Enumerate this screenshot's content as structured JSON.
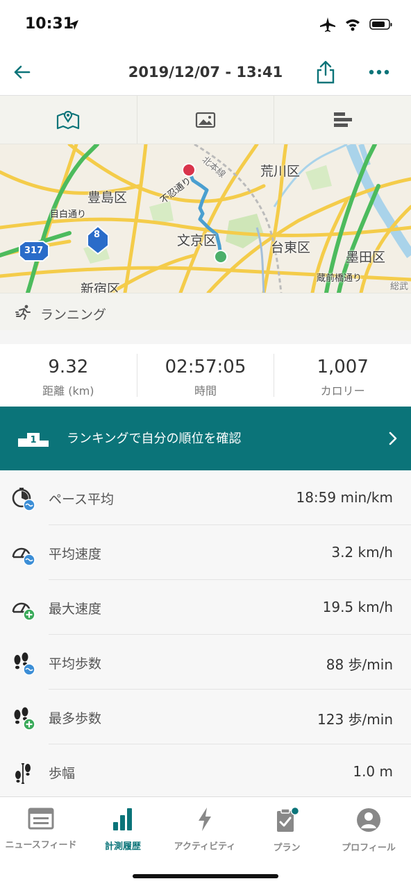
{
  "status": {
    "time": "10:31"
  },
  "header": {
    "title": "2019/12/07 - 13:41"
  },
  "view_tabs": [
    {
      "icon": "map-icon",
      "active": true
    },
    {
      "icon": "photo-icon",
      "active": false
    },
    {
      "icon": "stats-bars-icon",
      "active": false
    }
  ],
  "map": {
    "labels": {
      "arakawa": "荒川区",
      "toshima": "豊島区",
      "mejiro": "目白通り",
      "shinobazu": "不忍通り",
      "bunkyo": "文京区",
      "taito": "台東区",
      "sumida": "墨田区",
      "shinjuku": "新宿区",
      "kuramae": "蔵前橋通り",
      "sobu": "総武",
      "route8": "8",
      "route317": "317",
      "kitahon": "北本線"
    }
  },
  "activity": {
    "type": "ランニング"
  },
  "summary": {
    "distance": {
      "value": "9.32",
      "label": "距離 (km)"
    },
    "duration": {
      "value": "02:57:05",
      "label": "時間"
    },
    "calories": {
      "value": "1,007",
      "label": "カロリー"
    }
  },
  "ranking": {
    "rank": "1",
    "text": "ランキングで自分の順位を確認"
  },
  "metrics": [
    {
      "icon": "pace-avg-icon",
      "label": "ペース平均",
      "value": "18:59 min/km"
    },
    {
      "icon": "speed-avg-icon",
      "label": "平均速度",
      "value": "3.2 km/h"
    },
    {
      "icon": "speed-max-icon",
      "label": "最大速度",
      "value": "19.5 km/h"
    },
    {
      "icon": "cadence-avg-icon",
      "label": "平均歩数",
      "value": "88 歩/min"
    },
    {
      "icon": "cadence-max-icon",
      "label": "最多歩数",
      "value": "123 歩/min"
    },
    {
      "icon": "stride-icon",
      "label": "歩幅",
      "value": "1.0 m"
    }
  ],
  "tabbar": {
    "items": [
      {
        "icon": "newsfeed-icon",
        "label": "ニュースフィード",
        "active": false
      },
      {
        "icon": "history-icon",
        "label": "計測履歴",
        "active": true
      },
      {
        "icon": "activity-bolt-icon",
        "label": "アクティビティ",
        "active": false
      },
      {
        "icon": "plan-clipboard-icon",
        "label": "プラン",
        "active": false
      },
      {
        "icon": "profile-icon",
        "label": "プロフィール",
        "active": false
      }
    ]
  },
  "colors": {
    "accent": "#0b7479",
    "route": "#4a9fd0",
    "start": "#4caf6a",
    "end": "#d9344b"
  }
}
